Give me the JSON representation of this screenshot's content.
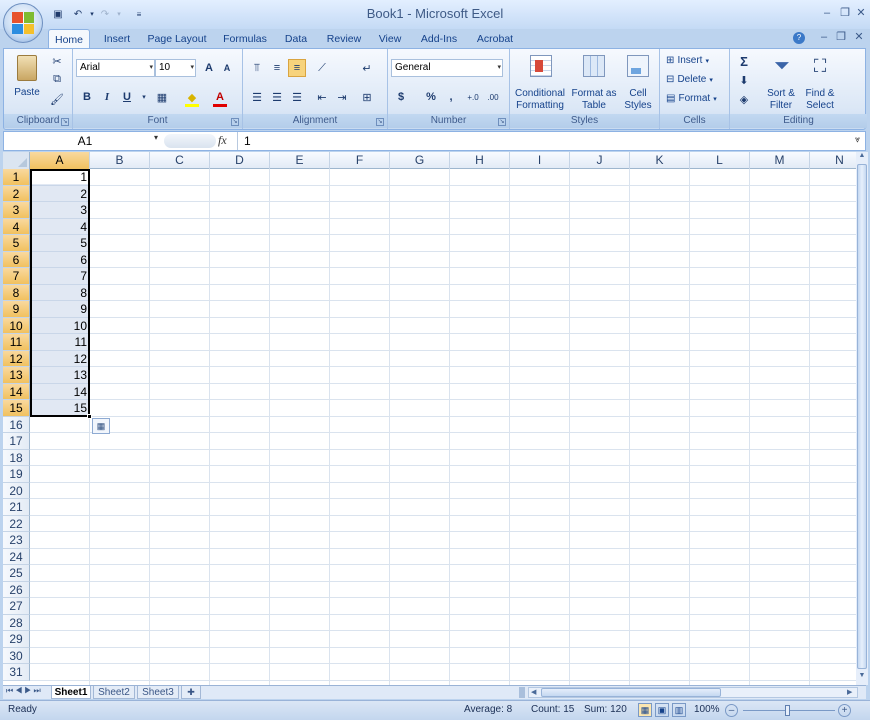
{
  "window": {
    "title": "Book1 - Microsoft Excel"
  },
  "ribbon": {
    "tabs": [
      "Home",
      "Insert",
      "Page Layout",
      "Formulas",
      "Data",
      "Review",
      "View",
      "Add-Ins",
      "Acrobat"
    ],
    "active_tab": "Home",
    "clipboard": {
      "label": "Clipboard",
      "paste": "Paste"
    },
    "font": {
      "label": "Font",
      "name": "Arial",
      "size": "10",
      "bold": "B",
      "italic": "I",
      "underline": "U",
      "grow": "A",
      "shrink": "A"
    },
    "alignment": {
      "label": "Alignment"
    },
    "number": {
      "label": "Number",
      "format": "General",
      "currency": "$",
      "percent": "%",
      "comma": ",",
      "inc_dec": "+.0",
      "dec_dec": ".00"
    },
    "styles": {
      "label": "Styles",
      "conditional": [
        "Conditional",
        "Formatting"
      ],
      "format_table": [
        "Format as",
        "Table"
      ],
      "cell_styles": [
        "Cell",
        "Styles"
      ]
    },
    "cells": {
      "label": "Cells",
      "insert": "Insert",
      "delete": "Delete",
      "format": "Format"
    },
    "editing": {
      "label": "Editing",
      "sigma": "Σ",
      "sort": [
        "Sort &",
        "Filter"
      ],
      "find": [
        "Find &",
        "Select"
      ]
    }
  },
  "formula_bar": {
    "name_box": "A1",
    "fx": "fx",
    "content": "1"
  },
  "grid": {
    "columns": [
      "A",
      "B",
      "C",
      "D",
      "E",
      "F",
      "G",
      "H",
      "I",
      "J",
      "K",
      "L",
      "M",
      "N"
    ],
    "selected_column": "A",
    "rows": [
      "1",
      "2",
      "3",
      "4",
      "5",
      "6",
      "7",
      "8",
      "9",
      "10",
      "11",
      "12",
      "13",
      "14",
      "15",
      "16",
      "17",
      "18",
      "19",
      "20",
      "21",
      "22",
      "23",
      "24",
      "25",
      "26",
      "27",
      "28",
      "29",
      "30",
      "31"
    ],
    "selected_rows": 15,
    "column_a_values": [
      "1",
      "2",
      "3",
      "4",
      "5",
      "6",
      "7",
      "8",
      "9",
      "10",
      "11",
      "12",
      "13",
      "14",
      "15"
    ]
  },
  "sheets": [
    "Sheet1",
    "Sheet2",
    "Sheet3"
  ],
  "active_sheet": "Sheet1",
  "status": {
    "ready": "Ready",
    "average": "Average: 8",
    "count": "Count: 15",
    "sum": "Sum: 120",
    "zoom": "100%"
  },
  "colors": {
    "selection_header": "#f5c96f",
    "ribbon_bg": "#dbe7f6",
    "frame": "#bcd3ee"
  }
}
